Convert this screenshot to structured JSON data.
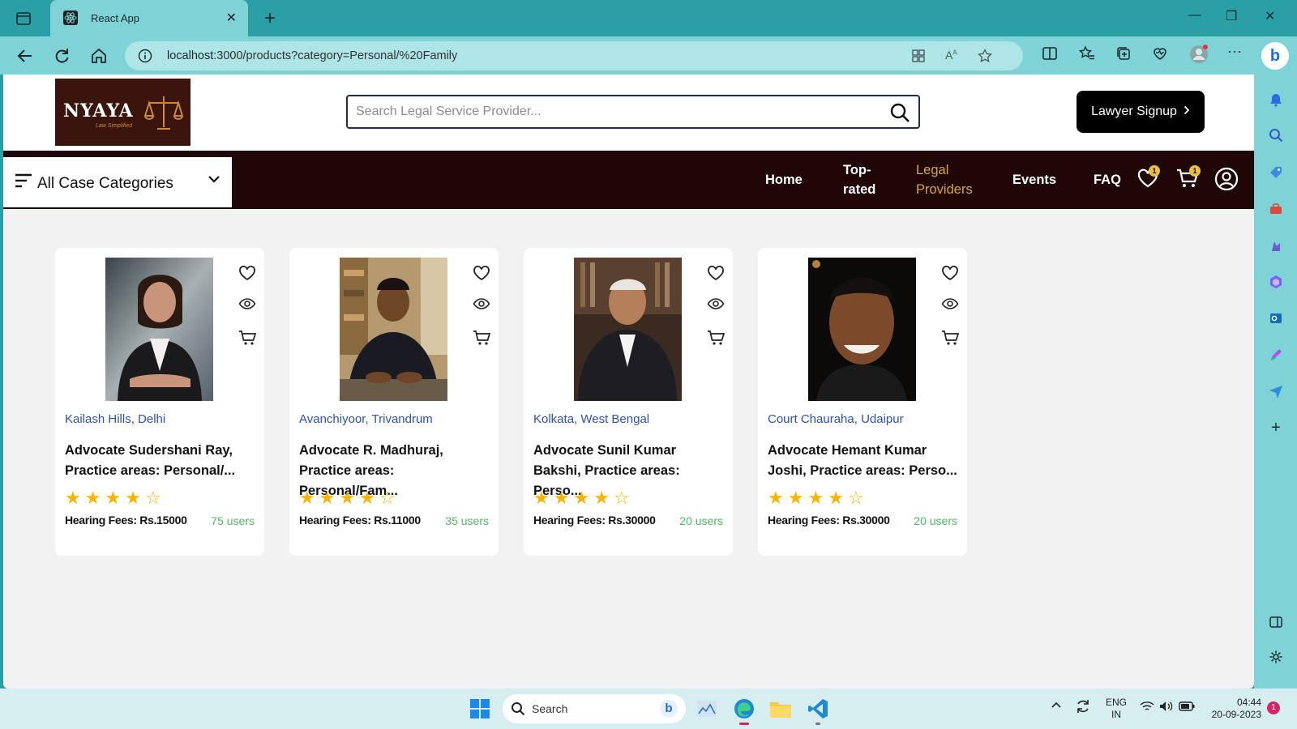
{
  "browser": {
    "tab_title": "React App",
    "url_host": "localhost",
    "url_path": ":3000/products?category=Personal/%20Family"
  },
  "header": {
    "logo_text": "NYAYA",
    "logo_tagline": "Law Simplified",
    "search_placeholder": "Search Legal Service Provider...",
    "signup_label": "Lawyer Signup"
  },
  "nav": {
    "categories_label": "All Case Categories",
    "links": [
      "Home",
      "Top-",
      "rated",
      "Legal",
      "Providers",
      "Events",
      "FAQ"
    ],
    "wishlist_count": "1",
    "cart_count": "1"
  },
  "cards": [
    {
      "location": "Kailash Hills, Delhi",
      "name": "Advocate Sudershani Ray, Practice areas: Personal/...",
      "rating": 4,
      "fees": "Hearing Fees: Rs.15000",
      "users": "75 users"
    },
    {
      "location": "Avanchiyoor, Trivandrum",
      "name": "Advocate R. Madhuraj, Practice areas: Personal/Fam...",
      "rating": 4,
      "fees": "Hearing Fees: Rs.11000",
      "users": "35 users"
    },
    {
      "location": "Kolkata, West Bengal",
      "name": "Advocate Sunil Kumar Bakshi, Practice areas: Perso...",
      "rating": 4,
      "fees": "Hearing Fees: Rs.30000",
      "users": "20 users"
    },
    {
      "location": "Court Chauraha, Udaipur",
      "name": "Advocate Hemant Kumar Joshi, Practice areas: Perso...",
      "rating": 4,
      "fees": "Hearing Fees: Rs.30000",
      "users": "20 users"
    }
  ],
  "taskbar": {
    "search_label": "Search",
    "lang1": "ENG",
    "lang2": "IN",
    "time": "04:44",
    "date": "20-09-2023"
  },
  "colors": {
    "nav_bg": "#200707",
    "accent": "#d6a54a",
    "star": "#f6b408",
    "location": "#2f52a8",
    "users": "#55b66a"
  }
}
